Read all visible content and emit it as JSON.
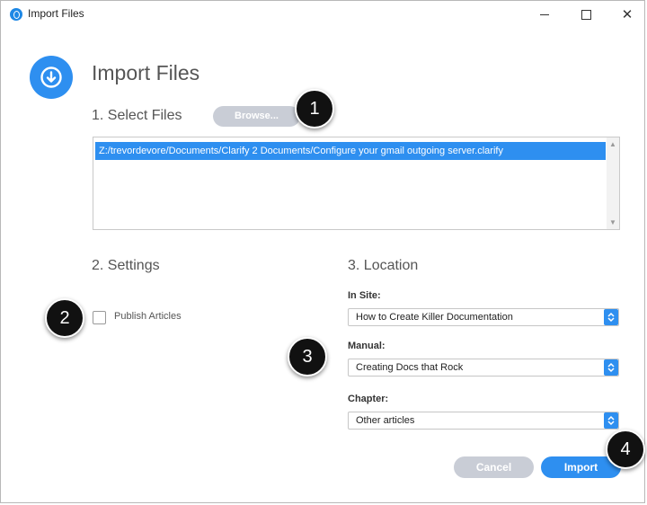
{
  "window": {
    "title": "Import Files",
    "controls": {
      "minimize": "—",
      "maximize": "□",
      "close": "✕"
    }
  },
  "header": {
    "title": "Import Files",
    "icon": "download-circle-icon"
  },
  "sections": {
    "select_files": {
      "title": "1. Select Files",
      "browse_label": "Browse..."
    },
    "settings": {
      "title": "2. Settings",
      "publish_label": "Publish Articles",
      "publish_checked": false
    },
    "location": {
      "title": "3. Location",
      "in_site_label": "In Site:",
      "in_site_value": "How to Create Killer Documentation",
      "manual_label": "Manual:",
      "manual_value": "Creating Docs that Rock",
      "chapter_label": "Chapter:",
      "chapter_value": "Other articles"
    }
  },
  "files": [
    "Z:/trevordevore/Documents/Clarify 2 Documents/Configure your gmail outgoing server.clarify"
  ],
  "buttons": {
    "cancel": "Cancel",
    "import": "Import"
  },
  "markers": [
    "1",
    "2",
    "3",
    "4"
  ],
  "colors": {
    "accent": "#2e8ff0",
    "disabled": "#c9cdd6",
    "marker": "#111111"
  }
}
